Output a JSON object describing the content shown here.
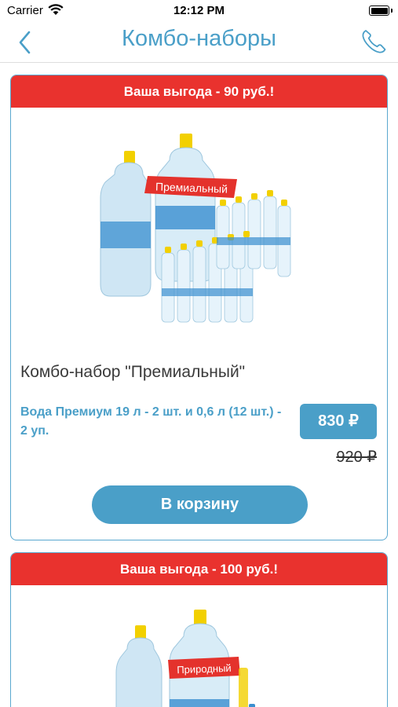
{
  "status_bar": {
    "carrier": "Carrier",
    "time": "12:12 PM"
  },
  "header": {
    "title": "Комбо-наборы",
    "back_icon": "chevron-left-icon",
    "call_icon": "phone-icon"
  },
  "products": [
    {
      "banner": "Ваша выгода - 90 руб.!",
      "image_label": "Премиальный",
      "name": "Комбо-набор \"Премиальный\"",
      "description": "Вода Премиум 19 л - 2 шт. и 0,6 л (12 шт.) - 2 уп.",
      "price": "830 ₽",
      "old_price": "920 ₽",
      "cart_label": "В корзину"
    },
    {
      "banner": "Ваша выгода - 100 руб.!",
      "image_label": "Природный"
    }
  ],
  "colors": {
    "accent": "#4a9fc8",
    "banner": "#e9322e",
    "bottle_cap": "#f2d000"
  }
}
